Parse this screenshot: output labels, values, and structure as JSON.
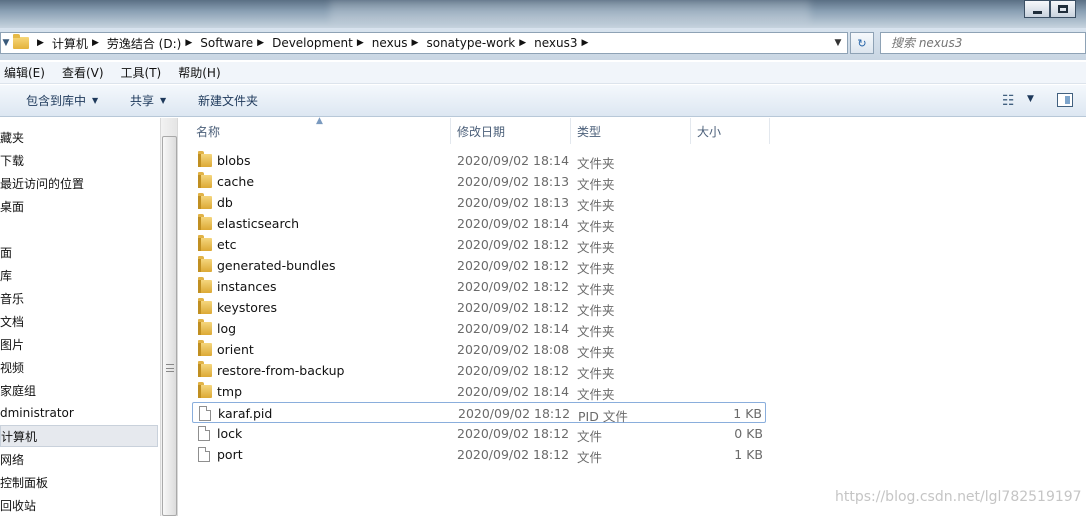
{
  "window": {},
  "address": {
    "crumbs": [
      "计算机",
      "劳逸结合 (D:)",
      "Software",
      "Development",
      "nexus",
      "sonatype-work",
      "nexus3"
    ],
    "search_placeholder": "搜索 nexus3"
  },
  "menu": [
    "编辑(E)",
    "查看(V)",
    "工具(T)",
    "帮助(H)"
  ],
  "toolbar": {
    "include_library": "包含到库中",
    "share": "共享",
    "new_folder": "新建文件夹"
  },
  "nav": [
    {
      "label": "藏夹",
      "indent": 0
    },
    {
      "label": "下载",
      "indent": 0
    },
    {
      "label": "最近访问的位置",
      "indent": 0
    },
    {
      "label": "桌面",
      "indent": 0
    },
    {
      "label": "",
      "indent": 0
    },
    {
      "label": "面",
      "indent": 0
    },
    {
      "label": "库",
      "indent": 0
    },
    {
      "label": "音乐",
      "indent": 0
    },
    {
      "label": "文档",
      "indent": 0
    },
    {
      "label": "图片",
      "indent": 0
    },
    {
      "label": "视频",
      "indent": 0
    },
    {
      "label": "家庭组",
      "indent": 0
    },
    {
      "label": "dministrator",
      "indent": 0
    },
    {
      "label": "计算机",
      "indent": 0
    },
    {
      "label": "网络",
      "indent": 0
    },
    {
      "label": "控制面板",
      "indent": 0
    },
    {
      "label": "回收站",
      "indent": 0
    }
  ],
  "columns": {
    "name": "名称",
    "date": "修改日期",
    "type": "类型",
    "size": "大小"
  },
  "files": [
    {
      "name": "blobs",
      "date": "2020/09/02 18:14",
      "type": "文件夹",
      "size": "",
      "icon": "folder-icon"
    },
    {
      "name": "cache",
      "date": "2020/09/02 18:13",
      "type": "文件夹",
      "size": "",
      "icon": "folder-icon"
    },
    {
      "name": "db",
      "date": "2020/09/02 18:13",
      "type": "文件夹",
      "size": "",
      "icon": "folder-icon"
    },
    {
      "name": "elasticsearch",
      "date": "2020/09/02 18:14",
      "type": "文件夹",
      "size": "",
      "icon": "folder-icon"
    },
    {
      "name": "etc",
      "date": "2020/09/02 18:12",
      "type": "文件夹",
      "size": "",
      "icon": "folder-icon"
    },
    {
      "name": "generated-bundles",
      "date": "2020/09/02 18:12",
      "type": "文件夹",
      "size": "",
      "icon": "folder-icon"
    },
    {
      "name": "instances",
      "date": "2020/09/02 18:12",
      "type": "文件夹",
      "size": "",
      "icon": "folder-icon"
    },
    {
      "name": "keystores",
      "date": "2020/09/02 18:12",
      "type": "文件夹",
      "size": "",
      "icon": "folder-icon"
    },
    {
      "name": "log",
      "date": "2020/09/02 18:14",
      "type": "文件夹",
      "size": "",
      "icon": "folder-icon"
    },
    {
      "name": "orient",
      "date": "2020/09/02 18:08",
      "type": "文件夹",
      "size": "",
      "icon": "folder-icon"
    },
    {
      "name": "restore-from-backup",
      "date": "2020/09/02 18:12",
      "type": "文件夹",
      "size": "",
      "icon": "folder-icon"
    },
    {
      "name": "tmp",
      "date": "2020/09/02 18:14",
      "type": "文件夹",
      "size": "",
      "icon": "folder-icon"
    },
    {
      "name": "karaf.pid",
      "date": "2020/09/02 18:12",
      "type": "PID 文件",
      "size": "1 KB",
      "icon": "file-icon"
    },
    {
      "name": "lock",
      "date": "2020/09/02 18:12",
      "type": "文件",
      "size": "0 KB",
      "icon": "file-icon"
    },
    {
      "name": "port",
      "date": "2020/09/02 18:12",
      "type": "文件",
      "size": "1 KB",
      "icon": "file-icon"
    }
  ],
  "watermark": "https://blog.csdn.net/lgl782519197"
}
